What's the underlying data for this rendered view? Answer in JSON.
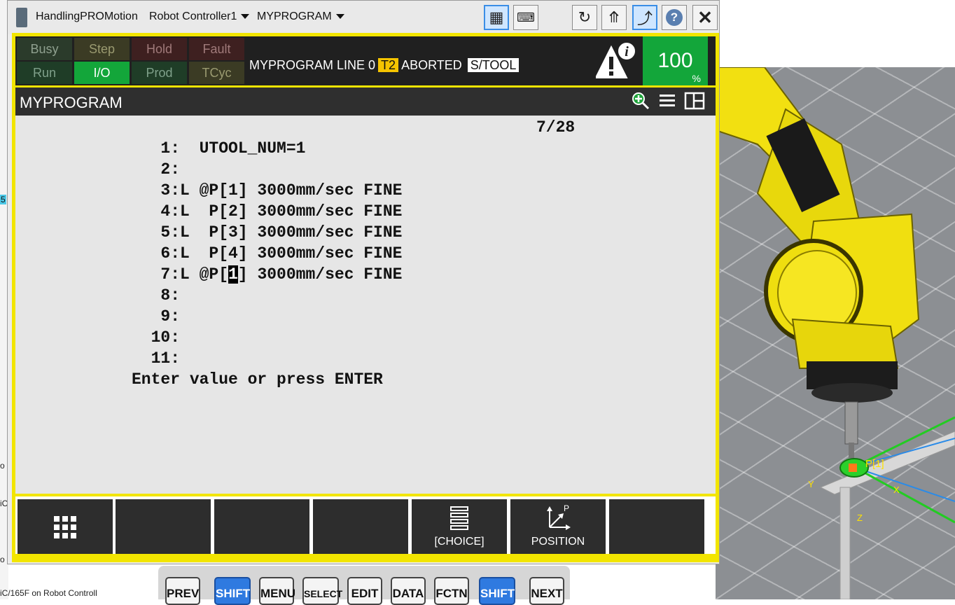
{
  "window": {
    "app_name": "HandlingPROMotion",
    "controller": "Robot Controller1",
    "program_menu": "MYPROGRAM"
  },
  "status_lamps": [
    {
      "label": "Busy",
      "active": false,
      "color": "#2b3b2b"
    },
    {
      "label": "Step",
      "active": false,
      "color": "#3b3b24"
    },
    {
      "label": "Hold",
      "active": false,
      "color": "#3e2020"
    },
    {
      "label": "Fault",
      "active": false,
      "color": "#3e2020"
    },
    {
      "label": "Run",
      "active": false,
      "color": "#1f3d27"
    },
    {
      "label": "I/O",
      "active": true,
      "color": "#13a63a"
    },
    {
      "label": "Prod",
      "active": false,
      "color": "#1f3d27"
    },
    {
      "label": "TCyc",
      "active": false,
      "color": "#3b3b24"
    }
  ],
  "status_line": {
    "program_line": "MYPROGRAM LINE 0",
    "mode": "T2",
    "state": "ABORTED",
    "frame": "S/TOOL"
  },
  "override": {
    "value": "100",
    "unit": "%"
  },
  "program": {
    "title": "MYPROGRAM",
    "position": "7/28",
    "lines": [
      "   1:  UTOOL_NUM=1",
      "   2:",
      "   3:L @P[1] 3000mm/sec FINE",
      "   4:L  P[2] 3000mm/sec FINE",
      "   5:L  P[3] 3000mm/sec FINE",
      "   6:L  P[4] 3000mm/sec FINE",
      "   7:L @P[",
      "   8:",
      "   9:",
      "  10:",
      "  11:"
    ],
    "cursor_char": "1",
    "line7_tail": "] 3000mm/sec FINE",
    "prompt": "Enter value or press ENTER"
  },
  "function_keys": [
    {
      "label": "",
      "icon": "grid-menu-icon"
    },
    {
      "label": ""
    },
    {
      "label": ""
    },
    {
      "label": ""
    },
    {
      "label": "[CHOICE]",
      "icon": "choice-list-icon"
    },
    {
      "label": "POSITION",
      "icon": "position-axes-icon"
    },
    {
      "label": ""
    }
  ],
  "hard_keys": [
    "PREV",
    "SHIFT",
    "MENU",
    "SELECT",
    "EDIT",
    "DATA",
    "FCTN",
    "SHIFT",
    "NEXT"
  ],
  "viewport": {
    "point_label": "P[1]",
    "axis_x": "X",
    "axis_y": "Y",
    "axis_z": "Z"
  },
  "left_fragments": [
    "5",
    "o",
    "iC",
    "o",
    "iC/165F on Robot Controll"
  ]
}
